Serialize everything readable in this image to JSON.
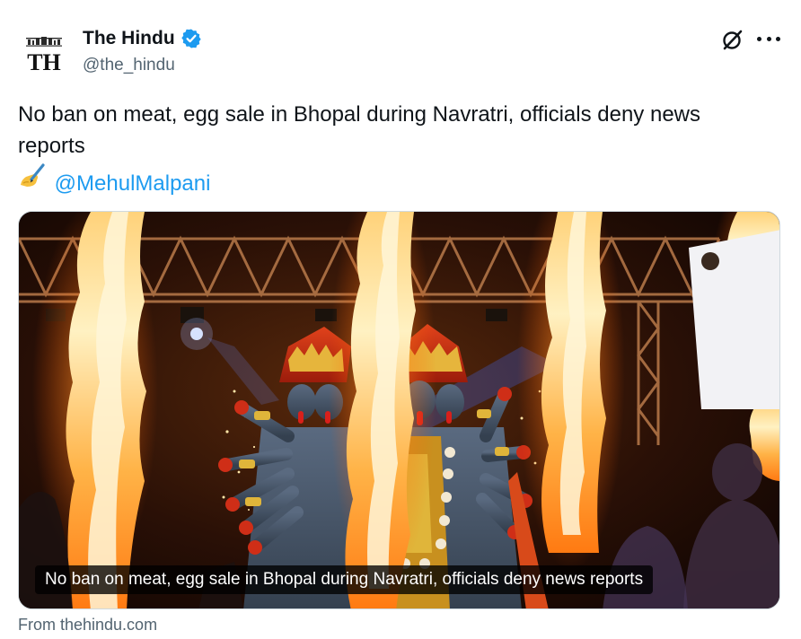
{
  "author": {
    "display_name": "The Hindu",
    "handle": "@the_hindu",
    "logo_text": "TH",
    "avatar_icon": "the-hindu-logo",
    "verified_icon": "verified-badge-icon",
    "verified_color": "#1d9bf0"
  },
  "header_actions": {
    "grok_icon": "grok-icon",
    "more_icon": "more-options-icon"
  },
  "tweet": {
    "line1": "No ban on meat, egg sale in Bhopal during Navratri, officials deny news",
    "line2": "reports",
    "emoji_icon": "writing-hand-emoji",
    "mention": "@MehulMalpani"
  },
  "card": {
    "image_description_icon": "kali-idol-fire-photo",
    "caption": "No ban on meat, egg sale in Bhopal during Navratri, officials deny news reports"
  },
  "source": {
    "label": "From thehindu.com"
  },
  "colors": {
    "text_primary": "#0f1419",
    "text_secondary": "#536471",
    "link": "#1d9bf0",
    "border": "#cfd9de"
  }
}
